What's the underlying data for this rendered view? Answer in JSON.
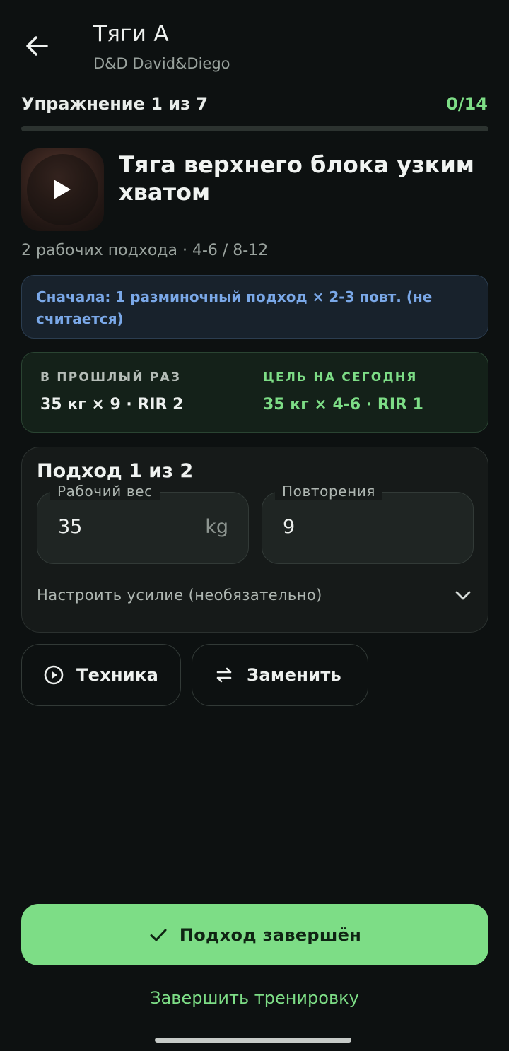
{
  "header": {
    "title": "Тяги А",
    "subtitle": "D&D David&Diego"
  },
  "progress": {
    "label": "Упражнение 1 из 7",
    "count": "0/14",
    "fraction": 0
  },
  "exercise": {
    "name": "Тяга верхнего блока узким хватом",
    "meta": "2 рабочих подхода · 4-6 / 8-12"
  },
  "warmup": {
    "text": "Сначала: 1 разминочный подход × 2-3 повт. (не считается)"
  },
  "comparison": {
    "last_label": "В ПРОШЛЫЙ РАЗ",
    "last_value": "35 кг × 9 · RIR 2",
    "target_label": "ЦЕЛЬ НА СЕГОДНЯ",
    "target_value": "35 кг × 4-6 · RIR 1"
  },
  "set": {
    "title": "Подход 1 из 2",
    "weight_label": "Рабочий вес",
    "weight_value": "35",
    "weight_unit": "kg",
    "reps_label": "Повторения",
    "reps_value": "9",
    "effort_label": "Настроить усилие (необязательно)"
  },
  "actions": {
    "technique_label": "Техника",
    "replace_label": "Заменить"
  },
  "footer": {
    "finish_set_label": "Подход завершён",
    "end_workout_label": "Завершить тренировку"
  },
  "colors": {
    "background": "#0d1111",
    "accent_green": "#7ddd86",
    "info_blue": "#7aa8e8"
  },
  "icons": {
    "back": "arrow-left-icon",
    "play": "play-icon",
    "chevron": "chevron-down-icon",
    "technique": "play-circle-icon",
    "replace": "swap-arrows-icon",
    "check": "check-icon"
  }
}
